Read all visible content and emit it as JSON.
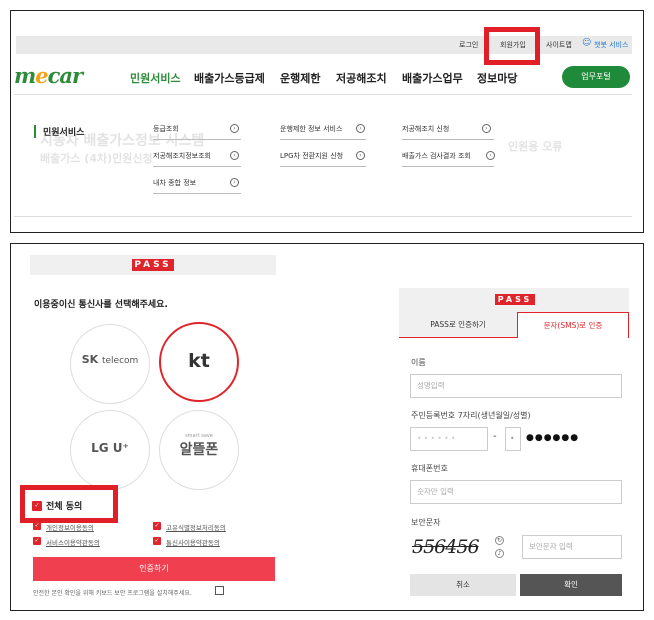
{
  "top": {
    "links": [
      "로그인",
      "회원가입",
      "사이트맵",
      "챗봇 서비스"
    ],
    "logo": {
      "m": "m",
      "e": "e",
      "car": "car"
    },
    "nav": [
      "민원서비스",
      "배출가스등급제",
      "운행제한",
      "저공해조치",
      "배출가스업무",
      "정보마당"
    ],
    "biz_button": "업무포털",
    "submenu_title": "민원서비스",
    "submenu": [
      [
        "등급조회",
        "운행제한 정보 서비스",
        "저공해조치 신청"
      ],
      [
        "저공해조치정보조회",
        "LPG차 전환지원 신청",
        "배출가스 검사결과 조회"
      ],
      [
        "내차 종합 정보",
        "",
        ""
      ]
    ],
    "ghost_texts": [
      "시동차 배출가스정보 시스템",
      "배출가스 (4차)민원신청",
      "인원용 오류"
    ]
  },
  "pass": {
    "logo": "PASS",
    "heading": "이용중이신 통신사를 선택해주세요.",
    "carriers": {
      "skt_line1": "SK",
      "skt_line2": "telecom",
      "kt": "kt",
      "lgu": "LG U⁺",
      "mvno_small": "smart save",
      "mvno": "알뜰폰"
    },
    "agree_all": "전체 동의",
    "agreements": [
      "개인정보이용동의",
      "고유식별정보처리동의",
      "서비스이용약관동의",
      "통신사이용약관동의"
    ],
    "submit": "인증하기",
    "footer_note": "안전한 본인 확인을 위해 키보드 보안 프로그램을 설치해주세요."
  },
  "sms": {
    "logo": "PASS",
    "tabs": [
      "PASS로 인증하기",
      "문자(SMS)로 인증"
    ],
    "name_label": "이름",
    "name_placeholder": "성명입력",
    "rrn_label": "주민등록번호 7자리(생년월일/성별)",
    "rrn_front": "• • • • • •",
    "rrn_dash": "-",
    "rrn_back_digit": "•",
    "rrn_masked": "●●●●●●",
    "phone_label": "휴대폰번호",
    "phone_placeholder": "숫자만 입력",
    "captcha_label": "보안문자",
    "captcha_value": "556456",
    "captcha_placeholder": "보안문자 입력",
    "cancel": "취소",
    "confirm": "확인"
  }
}
